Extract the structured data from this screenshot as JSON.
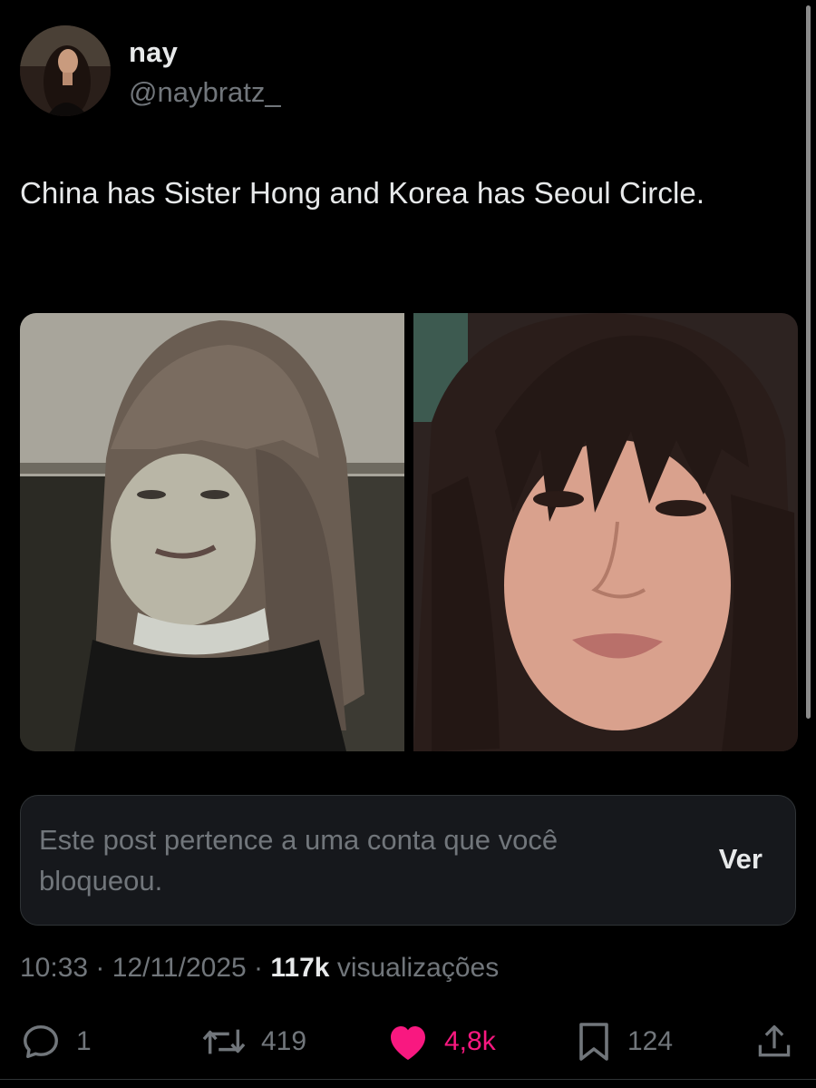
{
  "author": {
    "display_name": "nay",
    "handle": "@naybratz_",
    "avatar_icon": "profile-photo"
  },
  "tweet": {
    "text": "China has Sister Hong and Korea has Seoul Circle."
  },
  "media": [
    {
      "icon": "photo-person-long-hair-bangs"
    },
    {
      "icon": "photo-person-dark-hair-bangs"
    }
  ],
  "blocked_notice": {
    "text": "Este post pertence a uma conta que você bloqueou.",
    "button_label": "Ver"
  },
  "meta": {
    "time": "10:33",
    "separator": "·",
    "date": "12/11/2025",
    "views_count": "117k",
    "views_label": "visualizações"
  },
  "actions": {
    "replies": "1",
    "reposts": "419",
    "likes": "4,8k",
    "bookmarks": "124",
    "reply_icon": "speech-bubble-icon",
    "repost_icon": "repost-arrows-icon",
    "like_icon": "heart-icon",
    "bookmark_icon": "bookmark-icon",
    "share_icon": "share-upload-icon"
  },
  "colors": {
    "background": "#000000",
    "text_primary": "#e7e9ea",
    "text_secondary": "#71767b",
    "like_active": "#f91880",
    "card_background": "#16181c",
    "border": "#2f3336"
  }
}
